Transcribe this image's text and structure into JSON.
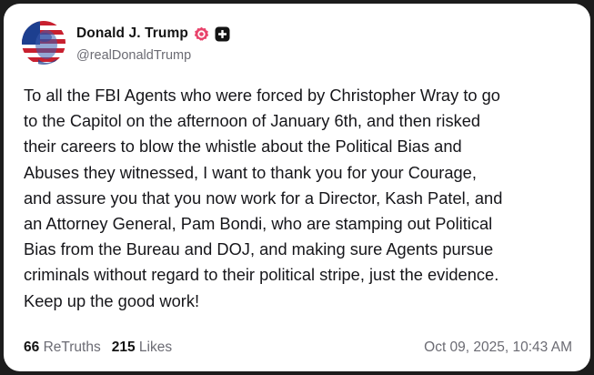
{
  "author": {
    "display_name": "Donald J. Trump",
    "handle": "@realDonaldTrump",
    "avatar_icon": "flag-portrait-avatar",
    "verified_badge_icon": "verified-badge-icon",
    "verified_badge_color": "#e8436b",
    "official_badge_icon": "plus-badge-icon",
    "official_badge_color": "#141414"
  },
  "post": {
    "lines": [
      "To all the FBI Agents who were forced by Christopher Wray to go",
      "to the Capitol on the afternoon of January 6th, and then risked",
      "their careers to blow the whistle about the Political Bias and",
      "Abuses they witnessed, I want to thank you for your Courage,",
      "and assure you that you now work for a Director, Kash Patel, and",
      "an Attorney General, Pam Bondi, who are stamping out Political",
      "Bias from the Bureau and DOJ, and making sure Agents pursue",
      "criminals without regard to their political stripe, just the evidence.",
      "Keep up the good work!"
    ]
  },
  "stats": {
    "retruths_count": "66",
    "retruths_label": "ReTruths",
    "likes_count": "215",
    "likes_label": "Likes"
  },
  "timestamp": "Oct 09, 2025, 10:43 AM",
  "colors": {
    "background": "#1c1c1c",
    "card": "#ffffff",
    "text": "#16161a",
    "muted": "#6b6b73"
  }
}
